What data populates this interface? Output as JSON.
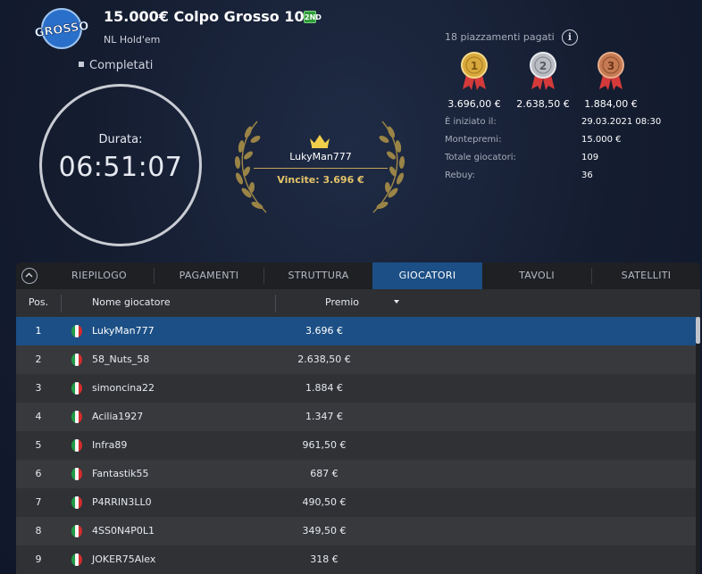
{
  "header": {
    "logo_text": "GROSSO",
    "title": "15.000€ Colpo Grosso 109",
    "badge": "2ND",
    "game_type": "NL Hold'em",
    "status": "Completati"
  },
  "timer": {
    "label": "Durata:",
    "value": "06:51:07"
  },
  "winner": {
    "name": "LukyMan777",
    "prize": "Vincite: 3.696 €"
  },
  "payouts": {
    "paid_places": "18 piazzamenti pagati",
    "medals": [
      {
        "rank": "1",
        "value": "3.696,00 €",
        "color": "#d8a93c"
      },
      {
        "rank": "2",
        "value": "2.638,50 €",
        "color": "#b9bcc2"
      },
      {
        "rank": "3",
        "value": "1.884,00 €",
        "color": "#c57a52"
      }
    ]
  },
  "stats": [
    {
      "label": "È iniziato il:",
      "value": "29.03.2021   08:30"
    },
    {
      "label": "Montepremi:",
      "value": "15.000 €"
    },
    {
      "label": "Totale giocatori:",
      "value": "109"
    },
    {
      "label": "Rebuy:",
      "value": "36"
    }
  ],
  "tabs": [
    "RIEPILOGO",
    "PAGAMENTI",
    "STRUTTURA",
    "GIOCATORI",
    "TAVOLI",
    "SATELLITI"
  ],
  "active_tab": "GIOCATORI",
  "table": {
    "headers": {
      "pos": "Pos.",
      "name": "Nome giocatore",
      "prize": "Premio"
    },
    "rows": [
      {
        "pos": "1",
        "name": "LukyMan777",
        "prize": "3.696 €"
      },
      {
        "pos": "2",
        "name": "58_Nuts_58",
        "prize": "2.638,50 €"
      },
      {
        "pos": "3",
        "name": "simoncina22",
        "prize": "1.884 €"
      },
      {
        "pos": "4",
        "name": "Acilia1927",
        "prize": "1.347 €"
      },
      {
        "pos": "5",
        "name": "Infra89",
        "prize": "961,50 €"
      },
      {
        "pos": "6",
        "name": "Fantastik55",
        "prize": "687 €"
      },
      {
        "pos": "7",
        "name": "P4RRIN3LL0",
        "prize": "490,50 €"
      },
      {
        "pos": "8",
        "name": "4SS0N4P0L1",
        "prize": "349,50 €"
      },
      {
        "pos": "9",
        "name": "JOKER75Alex",
        "prize": "318 €"
      }
    ],
    "selected_row": 0
  },
  "colors": {
    "accent": "#1c4f85",
    "gold": "#e4c46a",
    "flag_green": "#1f9a45",
    "flag_white": "#f4f4f4",
    "flag_red": "#d42b2b"
  }
}
